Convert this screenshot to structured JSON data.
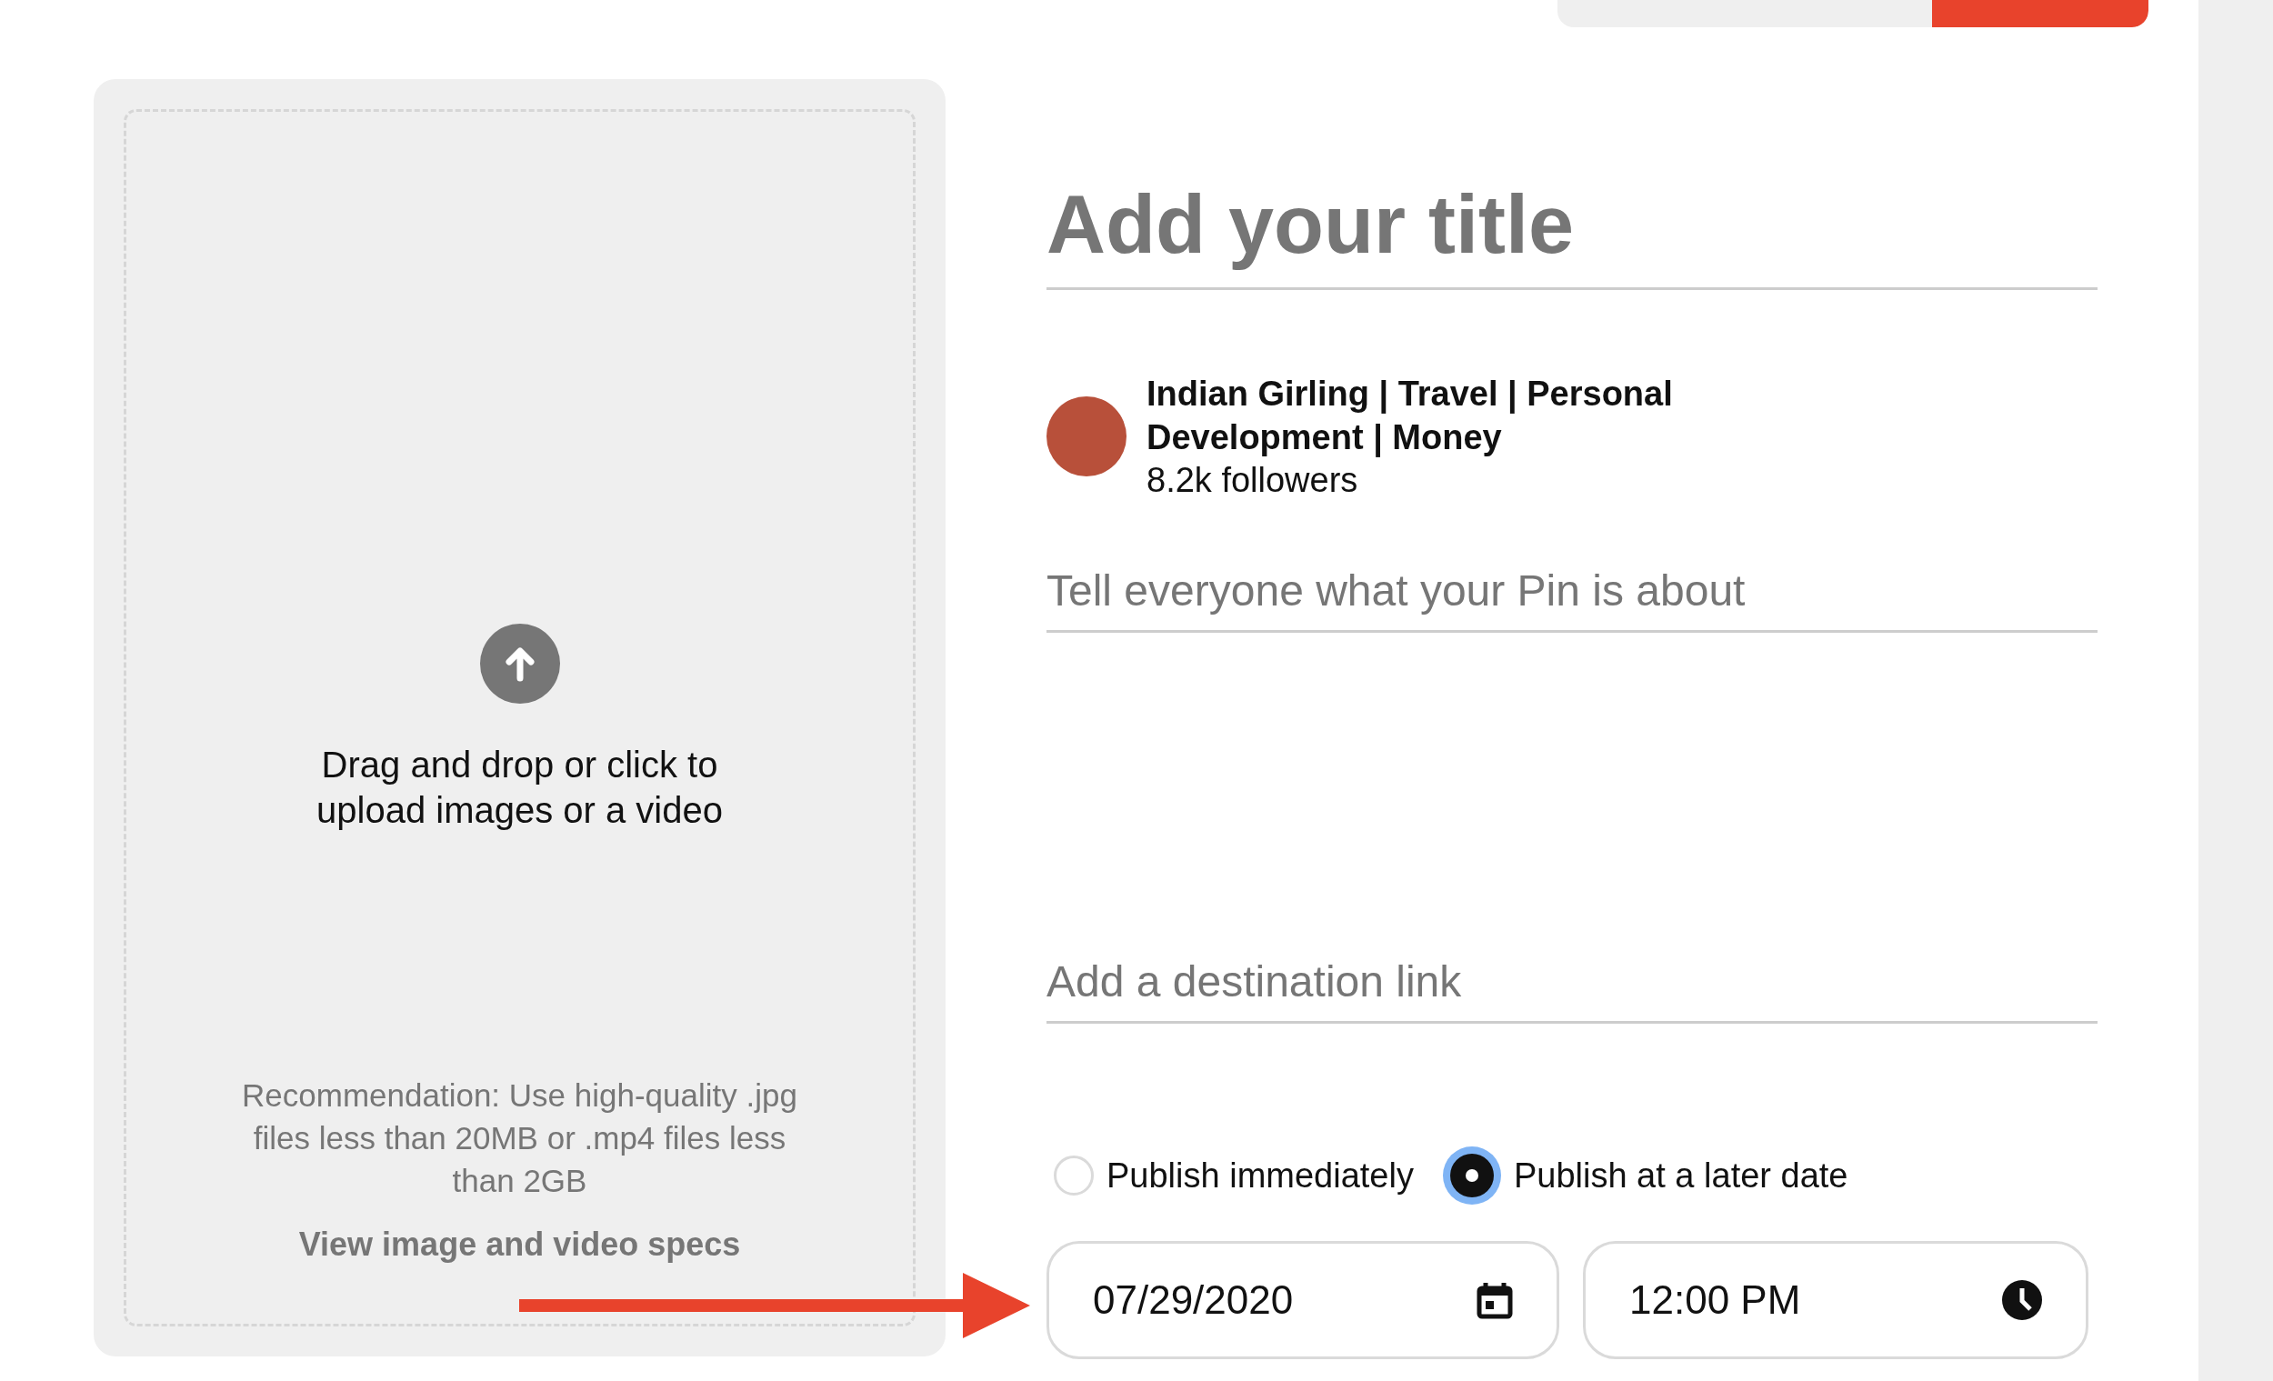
{
  "upload": {
    "prompt": "Drag and drop or click to upload images or a video",
    "recommendation": "Recommendation: Use high-quality .jpg files less than 20MB or .mp4 files less than 2GB",
    "specs_link": "View image and video specs"
  },
  "title": {
    "placeholder": "Add your title"
  },
  "profile": {
    "name": "Indian Girling | Travel | Personal Development | Money",
    "followers": "8.2k followers"
  },
  "description": {
    "placeholder": "Tell everyone what your Pin is about"
  },
  "link": {
    "placeholder": "Add a destination link"
  },
  "publish_options": [
    {
      "label": "Publish immediately",
      "selected": false
    },
    {
      "label": "Publish at a later date",
      "selected": true
    }
  ],
  "schedule": {
    "date": "07/29/2020",
    "time": "12:00 PM"
  }
}
